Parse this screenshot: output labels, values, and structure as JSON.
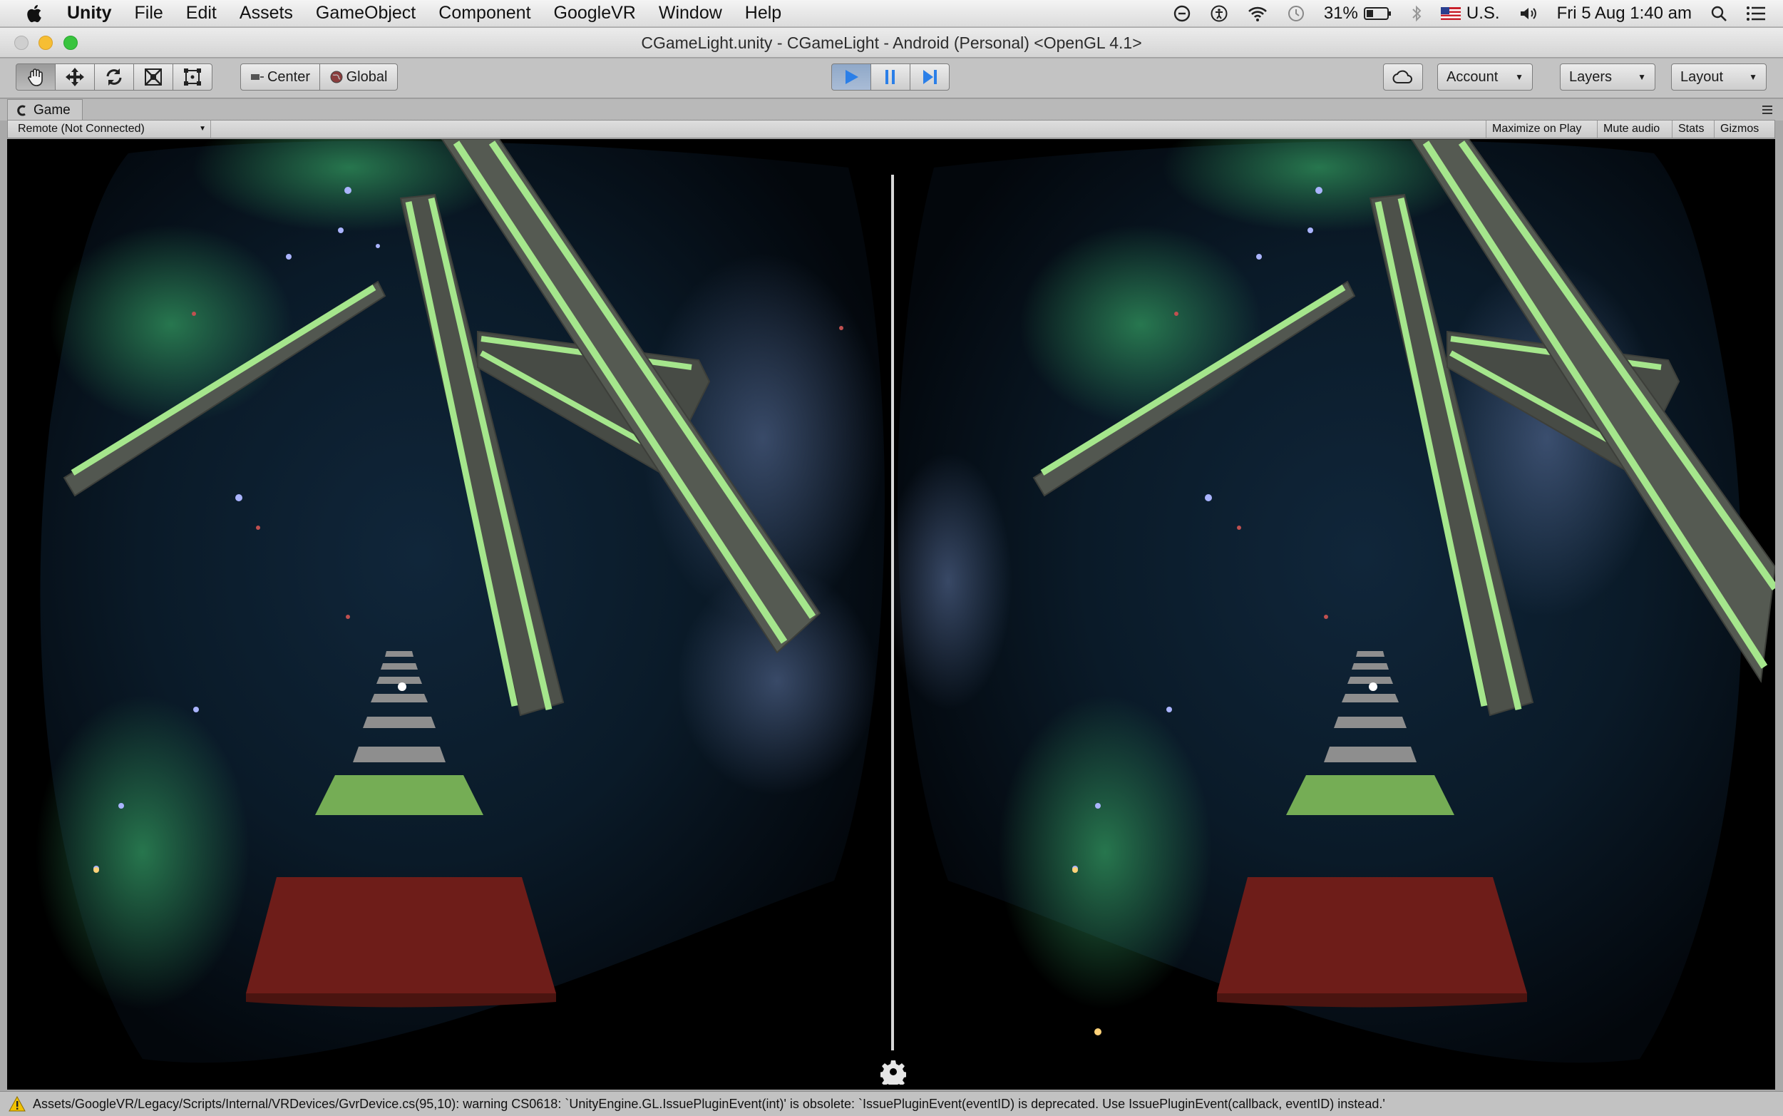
{
  "menubar": {
    "app": "Unity",
    "items": [
      "File",
      "Edit",
      "Assets",
      "GameObject",
      "Component",
      "GoogleVR",
      "Window",
      "Help"
    ],
    "status": {
      "battery": "31%",
      "input_source": "U.S.",
      "datetime": "Fri 5 Aug  1:40 am"
    }
  },
  "window": {
    "title": "CGameLight.unity - CGameLight - Android (Personal) <OpenGL 4.1>"
  },
  "toolbar": {
    "center_label": "Center",
    "global_label": "Global",
    "account_label": "Account",
    "layers_label": "Layers",
    "layout_label": "Layout"
  },
  "game_panel": {
    "tab_label": "Game",
    "remote_label": "Remote (Not Connected)",
    "maximize_label": "Maximize on Play",
    "mute_label": "Mute audio",
    "stats_label": "Stats",
    "gizmos_label": "Gizmos"
  },
  "console": {
    "message": "Assets/GoogleVR/Legacy/Scripts/Internal/VRDevices/GvrDevice.cs(95,10): warning CS0618: `UnityEngine.GL.IssuePluginEvent(int)' is obsolete: `IssuePluginEvent(eventID) is deprecated. Use IssuePluginEvent(callback, eventID) instead.'"
  },
  "colors": {
    "accent_play": "#2b7fe8",
    "track_green": "#7fb85f",
    "beam_edge": "#9fe08a",
    "pad_red": "#6e1d19"
  }
}
